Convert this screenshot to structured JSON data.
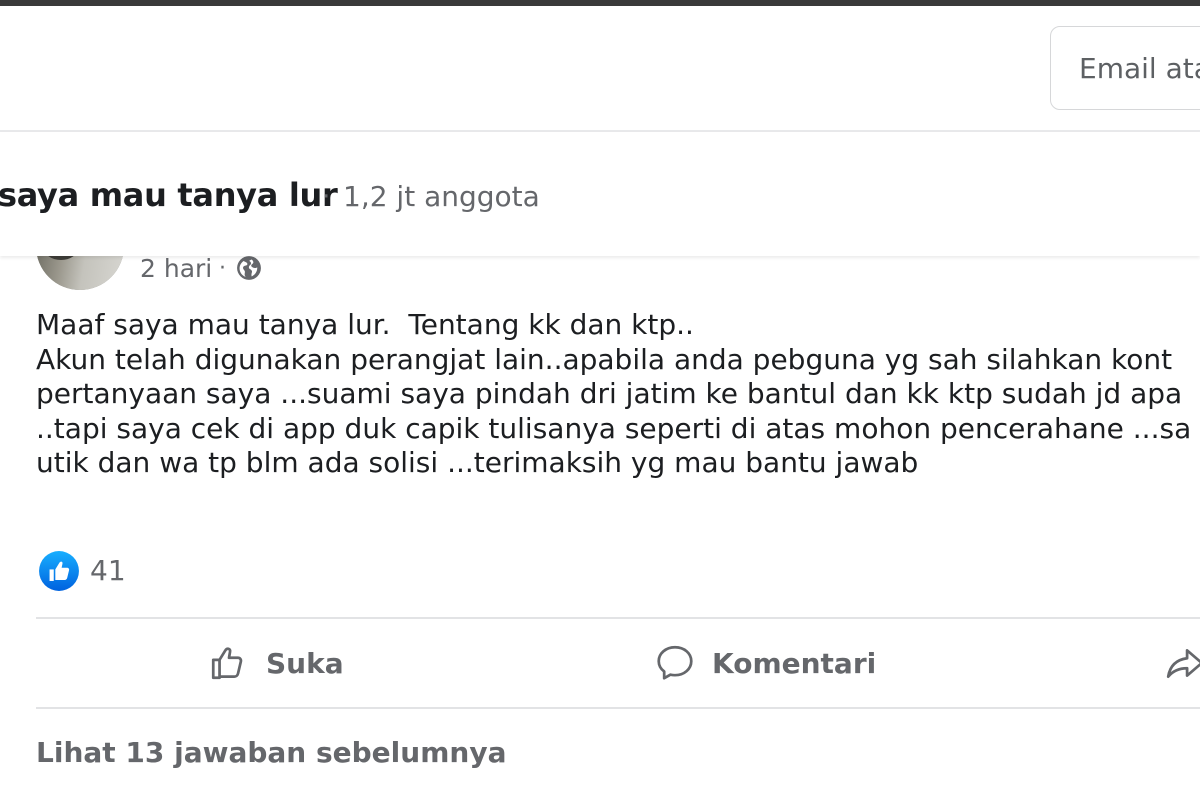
{
  "header": {
    "email_placeholder": "Email atau telepon"
  },
  "group": {
    "name": "saya mau tanya lur",
    "separator": "·",
    "members": "1,2 jt anggota"
  },
  "post": {
    "time": "2 hari",
    "time_separator": "·",
    "privacy_icon": "globe-icon",
    "lines": [
      "Maaf saya mau tanya lur.  Tentang kk dan ktp..",
      "Akun telah digunakan perangjat lain..apabila anda pebguna yg sah silahkan kont",
      "pertanyaan saya ...suami saya pindah dri jatim ke bantul dan kk ktp sudah jd apa",
      "..tapi saya cek di app duk capik tulisanya seperti di atas mohon pencerahane ...sa",
      "utik dan wa tp blm ada solisi ...terimaksih yg mau bantu jawab"
    ],
    "reaction_icon": "like-reaction-icon",
    "reaction_count": "41"
  },
  "actions": {
    "like_label": "Suka",
    "comment_label": "Komentari",
    "share_label": ""
  },
  "replies": {
    "view_previous_label": "Lihat 13 jawaban sebelumnya"
  },
  "colors": {
    "text_primary": "#1c1e21",
    "text_secondary": "#65676b",
    "like_blue": "#1877f2",
    "divider": "#e2e3e5"
  }
}
